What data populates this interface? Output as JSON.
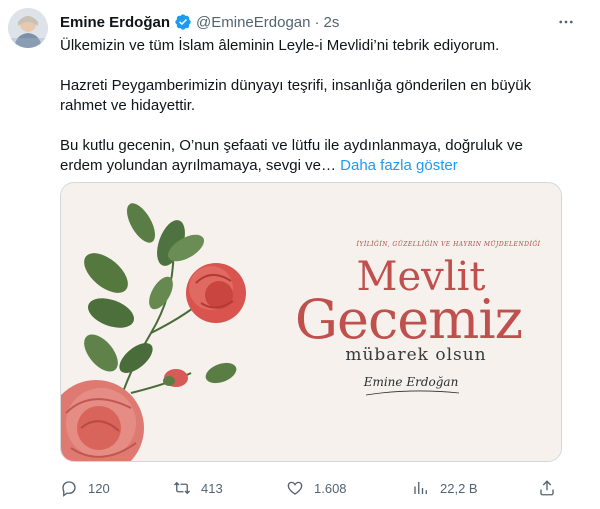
{
  "tweet": {
    "author_name": "Emine Erdoğan",
    "handle": "@EmineErdogan",
    "separator": "·",
    "time": "2s",
    "text_line1": "Ülkemizin ve tüm İslam âleminin Leyle-i Mevlidi’ni tebrik ediyorum.",
    "text_line2a": "Hazreti Peygamberimizin dünyayı teşrifi, insanlığa gönderilen en büyük",
    "text_line2b": "rahmet ve hidayettir.",
    "text_line3a": "Bu kutlu gecenin, O’nun şefaati ve lütfu ile aydınlanmaya, doğruluk ve",
    "text_line3b": "erdem yolundan ayrılmamaya, sevgi ve…",
    "show_more": "Daha fazla göster"
  },
  "media": {
    "subtitle": "İYİLİĞİN, GÜZELLİĞİN VE HAYRIN MÜJDELENDİĞİ",
    "title_line1": "Mevlit",
    "title_line2": "Gecemiz",
    "wish": "mübarek olsun",
    "signature": "Emine Erdoğan"
  },
  "actions": {
    "replies": "120",
    "retweets": "413",
    "likes": "1.608",
    "views": "22,2 B"
  },
  "icons": {
    "verified": "verified-badge-icon",
    "more": "more-icon",
    "reply": "reply-icon",
    "retweet": "retweet-icon",
    "like": "heart-icon",
    "views": "views-icon",
    "share": "share-icon"
  },
  "colors": {
    "link": "#1d9bf0",
    "secondary_text": "#536471",
    "title_red": "#c0504d"
  }
}
